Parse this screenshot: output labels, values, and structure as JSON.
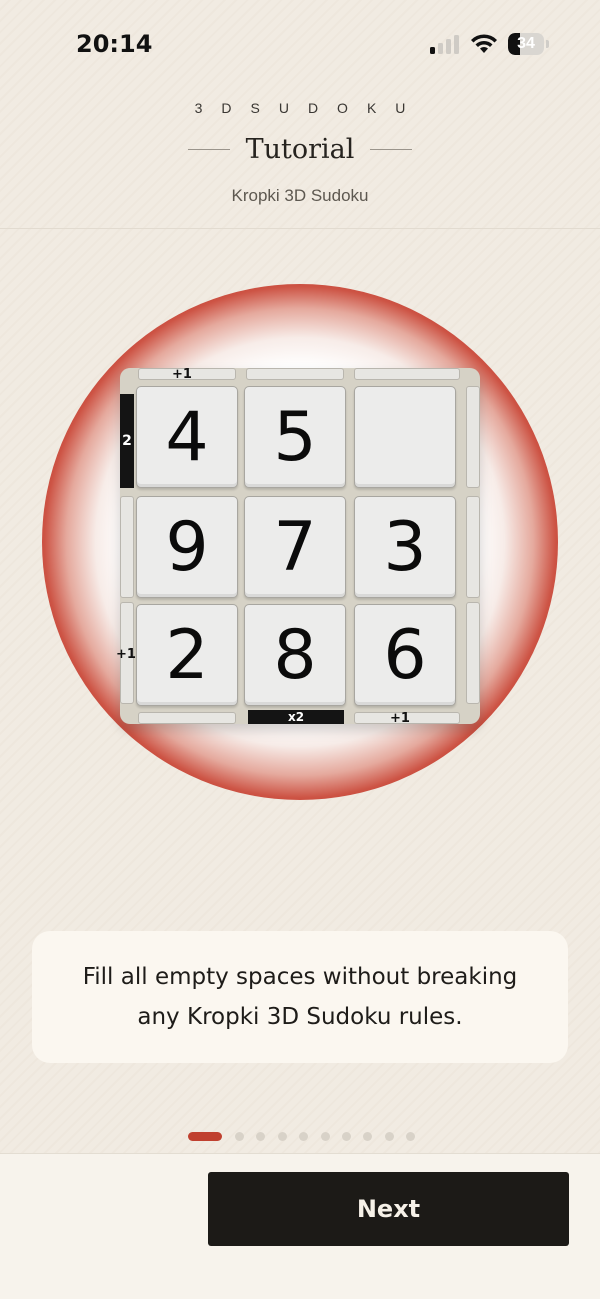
{
  "status_bar": {
    "time": "20:14",
    "battery_level": "34",
    "signal_bars_active": 1,
    "signal_bars_total": 4,
    "icons": [
      "cellular-signal-icon",
      "wifi-icon",
      "battery-icon"
    ]
  },
  "header": {
    "brand": "3DSUDOKU",
    "title": "Tutorial",
    "subtitle": "Kropki 3D Sudoku"
  },
  "puzzle": {
    "grid": [
      [
        "4",
        "5",
        ""
      ],
      [
        "9",
        "7",
        "3"
      ],
      [
        "2",
        "8",
        "6"
      ]
    ],
    "clues": {
      "top_left": "+1",
      "left_top": "2",
      "left_bottom": "+1",
      "bottom_middle": "x2",
      "bottom_right": "+1"
    }
  },
  "description": "Fill all empty spaces without breaking any Kropki 3D Sudoku rules.",
  "pagination": {
    "current_page": 1,
    "total_pages": 10
  },
  "footer": {
    "next_label": "Next"
  },
  "colors": {
    "accent_red": "#c0402f",
    "background": "#f1ebe2",
    "button_dark": "#1c1a17",
    "card": "#fbf7f0"
  }
}
